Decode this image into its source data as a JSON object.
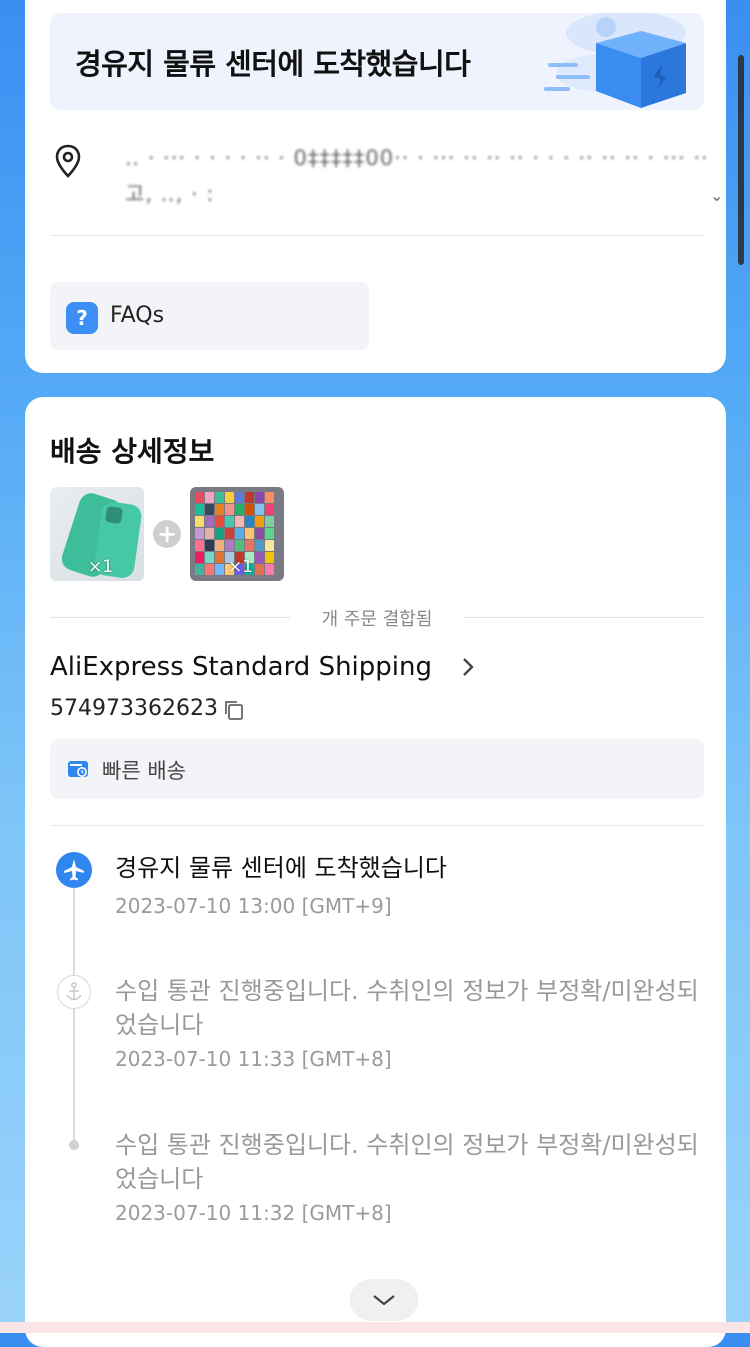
{
  "status": {
    "title": "경유지 물류 센터에 도착했습니다"
  },
  "address": {
    "line1": "‥ · ··· ·  ·  ·  ·  ··  · 0‡‡‡‡‡00·· ·  ··· ·· ·· ·· · ·  · ·· ·· ·· ·  ··· ·· ·· ·  · ·  ·  · ·· ·· ·· ···  ·· ·· ·",
    "line2": "고,  ‥,   ·       :",
    "chevron": "⌄"
  },
  "faq": {
    "icon": "?",
    "label": "FAQs"
  },
  "details": {
    "title": "배송 상세정보",
    "products": [
      {
        "qty": "×1"
      },
      {
        "qty": "×1"
      }
    ],
    "combined_label": "개 주문 결합됨",
    "shipping_method": "AliExpress Standard Shipping",
    "tracking_number": "574973362623",
    "fast_delivery": "빠른 배송"
  },
  "timeline": [
    {
      "title": "경유지 물류 센터에 도착했습니다",
      "time": "2023-07-10 13:00 [GMT+9]",
      "state": "active"
    },
    {
      "title": "수입 통관 진행중입니다. 수취인의 정보가 부정확/미완성되었습니다",
      "time": "2023-07-10 11:33 [GMT+8]",
      "state": "past"
    },
    {
      "title": "수입 통관 진행중입니다. 수취인의 정보가 부정확/미완성되었습니다",
      "time": "2023-07-10 11:32 [GMT+8]",
      "state": "past"
    }
  ],
  "colors": {
    "accent": "#2f86ee",
    "background_top": "#3b8ef2",
    "banner": "#eef3fe"
  }
}
